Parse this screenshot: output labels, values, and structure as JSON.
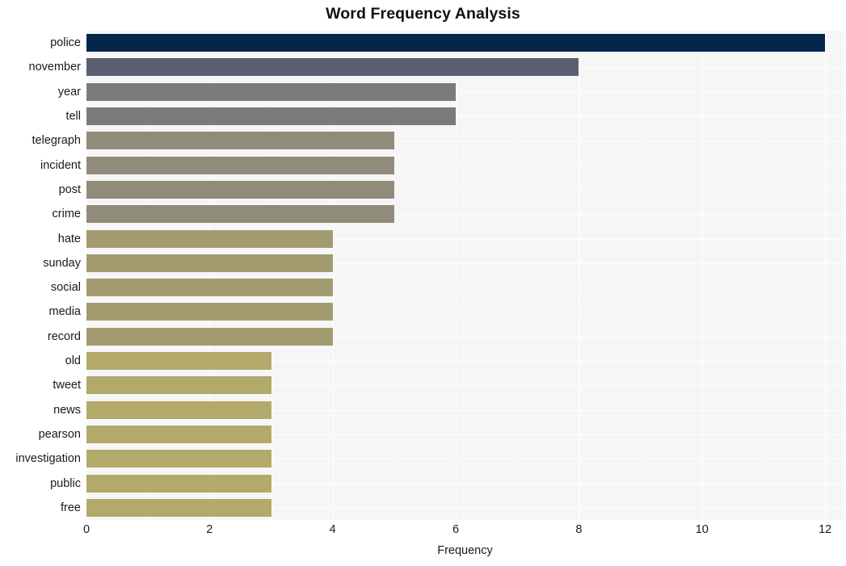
{
  "chart_data": {
    "type": "bar",
    "orientation": "horizontal",
    "title": "Word Frequency Analysis",
    "xlabel": "Frequency",
    "ylabel": "",
    "categories": [
      "police",
      "november",
      "year",
      "tell",
      "telegraph",
      "incident",
      "post",
      "crime",
      "hate",
      "sunday",
      "social",
      "media",
      "record",
      "old",
      "tweet",
      "news",
      "pearson",
      "investigation",
      "public",
      "free"
    ],
    "values": [
      12,
      8,
      6,
      6,
      5,
      5,
      5,
      5,
      4,
      4,
      4,
      4,
      4,
      3,
      3,
      3,
      3,
      3,
      3,
      3
    ],
    "bar_colors": [
      "#04254c",
      "#5a6070",
      "#7c7b79",
      "#7c7b79",
      "#918b79",
      "#918b79",
      "#918b79",
      "#918b79",
      "#a39b6f",
      "#a39b6f",
      "#a39b6f",
      "#a39b6f",
      "#a39b6f",
      "#b3a96a",
      "#b3a96a",
      "#b3a96a",
      "#b3a96a",
      "#b3a96a",
      "#b3a96a",
      "#b3a96a"
    ],
    "xlim": [
      0,
      12.3
    ],
    "x_ticks": [
      0,
      2,
      4,
      6,
      8,
      10,
      12
    ],
    "x_tick_labels": [
      "0",
      "2",
      "4",
      "6",
      "8",
      "10",
      "12"
    ],
    "x_minor_ticks": [
      1,
      3,
      5,
      7,
      9,
      11
    ],
    "grid": true,
    "grid_color": "#ffffff",
    "plot_background": "#f6f6f7",
    "figure_background": "#ffffff",
    "legend": null
  }
}
